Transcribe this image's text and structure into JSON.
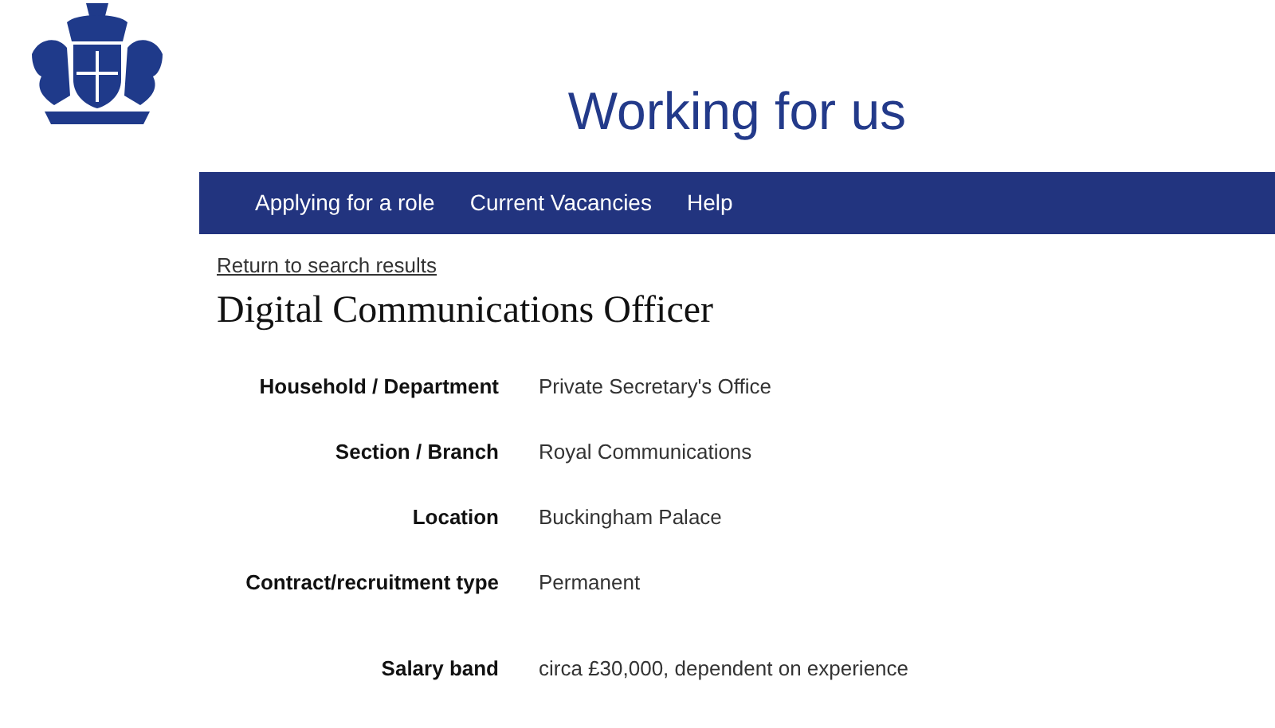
{
  "header": {
    "title": "Working for us"
  },
  "nav": [
    {
      "label": "Applying for a role"
    },
    {
      "label": "Current Vacancies"
    },
    {
      "label": "Help"
    }
  ],
  "back_link": "Return to search results",
  "job_title": "Digital Communications Officer",
  "details": [
    {
      "label": "Household / Department",
      "value": "Private Secretary's Office"
    },
    {
      "label": "Section / Branch",
      "value": "Royal Communications"
    },
    {
      "label": "Location",
      "value": "Buckingham Palace"
    },
    {
      "label": "Contract/recruitment type",
      "value": "Permanent"
    }
  ],
  "pay_details": [
    {
      "label": "Salary band",
      "value": "circa £30,000, dependent on experience"
    }
  ]
}
